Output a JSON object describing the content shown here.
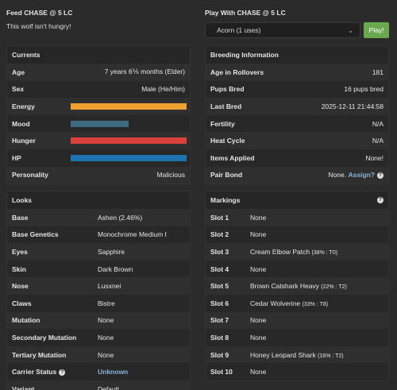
{
  "feed": {
    "title": "Feed CHASE @ 5 LC",
    "message": "This wolf isn't hungry!"
  },
  "play": {
    "title": "Play With CHASE @ 5 LC",
    "selected": "Acorn (1 uses)",
    "button": "Play!"
  },
  "currents": {
    "title": "Currents",
    "age_label": "Age",
    "age": "7 years 6⅙ months (Elder)",
    "sex_label": "Sex",
    "sex": "Male (He/Him)",
    "energy_label": "Energy",
    "energy_level": 1.0,
    "energy_color": "#f0a030",
    "mood_label": "Mood",
    "mood_level": 0.5,
    "mood_color": "#3d6b82",
    "hunger_label": "Hunger",
    "hunger_level": 1.0,
    "hunger_color": "#d9413a",
    "hp_label": "HP",
    "hp_level": 1.0,
    "hp_color": "#1e74b0",
    "personality_label": "Personality",
    "personality": "Malicious"
  },
  "breeding": {
    "title": "Breeding Information",
    "rows": [
      {
        "label": "Age in Rollovers",
        "value": "181"
      },
      {
        "label": "Pups Bred",
        "value": "16 pups bred"
      },
      {
        "label": "Last Bred",
        "value": "2025-12-11 21:44:58"
      },
      {
        "label": "Fertility",
        "value": "N/A"
      },
      {
        "label": "Heat Cycle",
        "value": "N/A"
      },
      {
        "label": "Items Applied",
        "value": "None!"
      }
    ],
    "pair_label": "Pair Bond",
    "pair_value": "None.",
    "pair_link": "Assign?",
    "help_glyph": "?"
  },
  "looks": {
    "title": "Looks",
    "rows": [
      {
        "label": "Base",
        "value": "Ashen (2.46%)"
      },
      {
        "label": "Base Genetics",
        "value": "Monochrome Medium I"
      },
      {
        "label": "Eyes",
        "value": "Sapphire"
      },
      {
        "label": "Skin",
        "value": "Dark Brown"
      },
      {
        "label": "Nose",
        "value": "Lusxnei"
      },
      {
        "label": "Claws",
        "value": "Bistre"
      },
      {
        "label": "Mutation",
        "value": "None"
      },
      {
        "label": "Secondary Mutation",
        "value": "None"
      },
      {
        "label": "Tertiary Mutation",
        "value": "None"
      }
    ],
    "carrier_label": "Carrier Status",
    "carrier_value": "Unknown",
    "variant_label": "Variant",
    "variant_value": "Default"
  },
  "markings": {
    "title": "Markings",
    "rows": [
      {
        "label": "Slot 1",
        "value": "None",
        "extra": ""
      },
      {
        "label": "Slot 2",
        "value": "None",
        "extra": ""
      },
      {
        "label": "Slot 3",
        "value": "Cream Elbow Patch",
        "extra": "(38% : T0)"
      },
      {
        "label": "Slot 4",
        "value": "None",
        "extra": ""
      },
      {
        "label": "Slot 5",
        "value": "Brown Catshark Heavy",
        "extra": "(22% : T2)"
      },
      {
        "label": "Slot 6",
        "value": "Cedar Wolverine",
        "extra": "(33% : T8)"
      },
      {
        "label": "Slot 7",
        "value": "None",
        "extra": ""
      },
      {
        "label": "Slot 8",
        "value": "None",
        "extra": ""
      },
      {
        "label": "Slot 9",
        "value": "Honey Leopard Shark",
        "extra": "(16% : T2)"
      },
      {
        "label": "Slot 10",
        "value": "None",
        "extra": ""
      }
    ]
  }
}
